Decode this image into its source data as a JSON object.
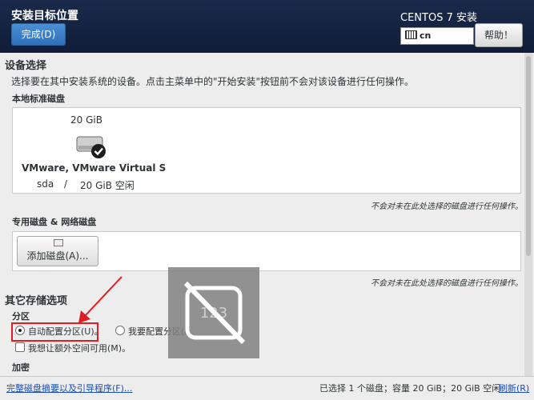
{
  "header": {
    "title": "安装目标位置",
    "done_label": "完成(D)",
    "product": "CENTOS 7 安装",
    "keyboard_layout": "cn",
    "help_label": "帮助！"
  },
  "device_selection": {
    "title": "设备选择",
    "description": "选择要在其中安装系统的设备。点击主菜单中的\"开始安装\"按钮前不会对该设备进行任何操作。",
    "local_disks": {
      "title": "本地标准磁盘",
      "disk": {
        "size": "20 GiB",
        "name": "VMware, VMware Virtual S",
        "device": "sda",
        "separator": "/",
        "free": "20 GiB 空闲",
        "icon": "hard-disk-selected-icon"
      },
      "note": "不会对未在此处选择的磁盘进行任何操作。"
    },
    "special_disks": {
      "title": "专用磁盘 & 网络磁盘",
      "add_button": "添加磁盘(A)...",
      "note": "不会对未在此处选择的磁盘进行任何操作。"
    }
  },
  "other_storage": {
    "title": "其它存储选项",
    "partition": {
      "title": "分区",
      "auto_label": "自动配置分区(U)。",
      "manual_label": "我要配置分区(I)。",
      "extra_space_label": "我想让额外空间可用(M)。",
      "selected": "auto"
    },
    "encryption_title": "加密"
  },
  "footer": {
    "summary_link": "完整磁盘摘要以及引导程序(F)...",
    "status": "已选择 1 个磁盘；容量 20 GiB；20 GiB 空闲",
    "refresh_link": "刷新(R)"
  },
  "colors": {
    "header_bg": "#1b2a4a",
    "done_button": "#3b7fc9",
    "highlight": "#e31b23",
    "link": "#1c4fb5"
  },
  "overlay_icon": "image-unavailable-icon"
}
